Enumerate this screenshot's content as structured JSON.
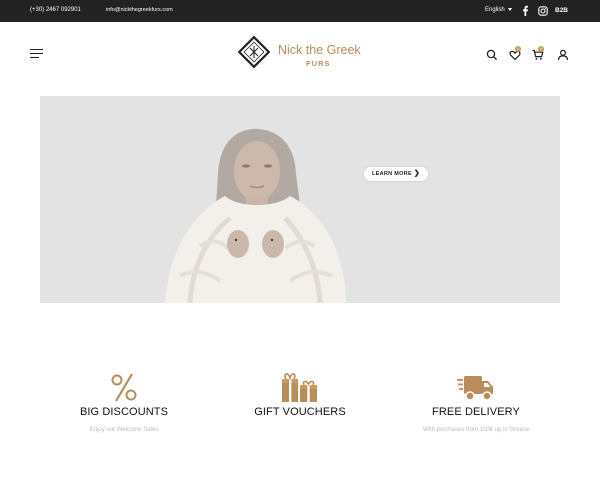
{
  "topbar": {
    "phone": "(+30) 2467 092901",
    "email": "info@nickthegreekfurs.com",
    "language": "English",
    "b2b": "B2B"
  },
  "header": {
    "brand_title": "Nick the Greek",
    "brand_subtitle": "FURS",
    "wishlist_count": "0",
    "cart_count": "0"
  },
  "hero": {
    "button_label": "LEARN MORE"
  },
  "features": [
    {
      "icon": "percent-icon",
      "title": "BIG DISCOUNTS",
      "subtitle": "Enjoy our Welcome Sales"
    },
    {
      "icon": "gift-icon",
      "title": "GIFT VOUCHERS",
      "subtitle": ""
    },
    {
      "icon": "delivery-truck-icon",
      "title": "FREE DELIVERY",
      "subtitle": "With purchases from 100€ up in Greece"
    }
  ],
  "colors": {
    "accent": "#b98c5c",
    "topbar_bg": "#222222",
    "hero_bg": "#e3e3e3"
  }
}
